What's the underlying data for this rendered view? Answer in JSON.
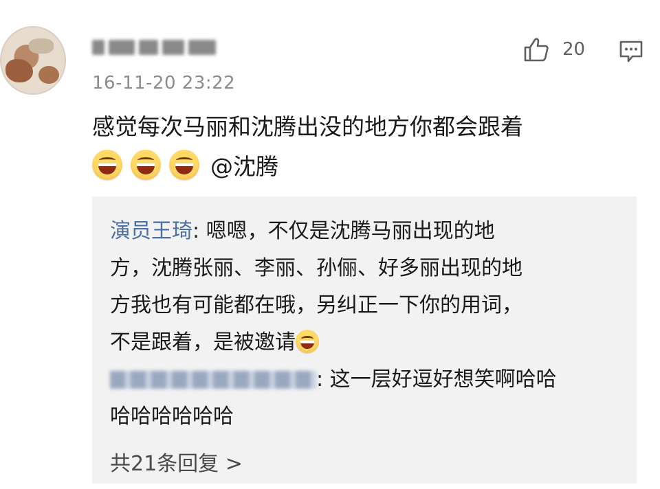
{
  "post": {
    "timestamp": "16-11-20 23:22",
    "like_count": "20",
    "text": "感觉每次马丽和沈腾出没的地方你都会跟着",
    "mention": "@沈腾"
  },
  "replies": {
    "first": {
      "user": "演员王琦",
      "separator": ": ",
      "line1": "嗯嗯，不仅是沈腾马丽出现的地",
      "line2": "方，沈腾张丽、李丽、孙俪、好多丽出现的地",
      "line3": "方我也有可能都在哦，另纠正一下你的用词，",
      "line4": "不是跟着，是被邀请"
    },
    "second": {
      "separator": ": ",
      "line1": "这一层好逗好想笑啊哈哈",
      "line2": "哈哈哈哈哈哈"
    },
    "more_label": "共21条回复 >"
  },
  "icons": {
    "like": "thumbs-up-icon",
    "comment": "comment-icon",
    "emoji": "laughing-emoji-icon"
  },
  "colors": {
    "username_link": "#4a6fa5",
    "reply_bg": "#f2f2f2",
    "timestamp": "#8c8c8c"
  }
}
